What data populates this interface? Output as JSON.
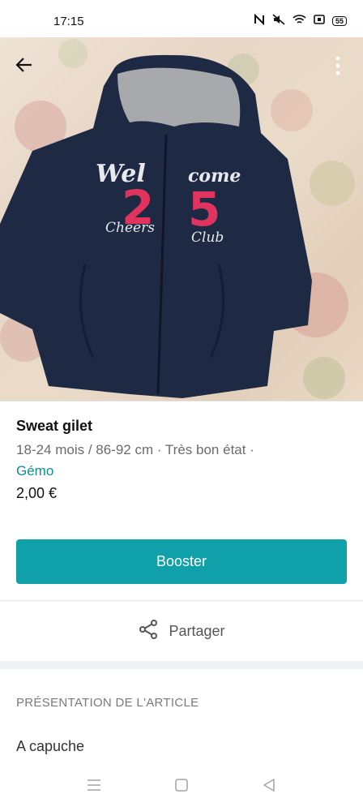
{
  "status_bar": {
    "time": "17:15",
    "battery": "55"
  },
  "item": {
    "title": "Sweat gilet",
    "meta": "18-24 mois / 86-92 cm · Très bon état ·",
    "brand": "Gémo",
    "price": "2,00 €"
  },
  "actions": {
    "boost_label": "Booster",
    "share_label": "Partager"
  },
  "section": {
    "heading": "PRÉSENTATION DE L'ARTICLE",
    "description": "A capuche"
  },
  "colors": {
    "accent": "#10a0aa",
    "brand_text": "#0b8f8f"
  },
  "icons": [
    "back-arrow-icon",
    "more-vertical-icon",
    "share-icon",
    "nfc-icon",
    "mute-icon",
    "wifi-icon",
    "menu-icon",
    "home-icon",
    "back-triangle-icon"
  ]
}
